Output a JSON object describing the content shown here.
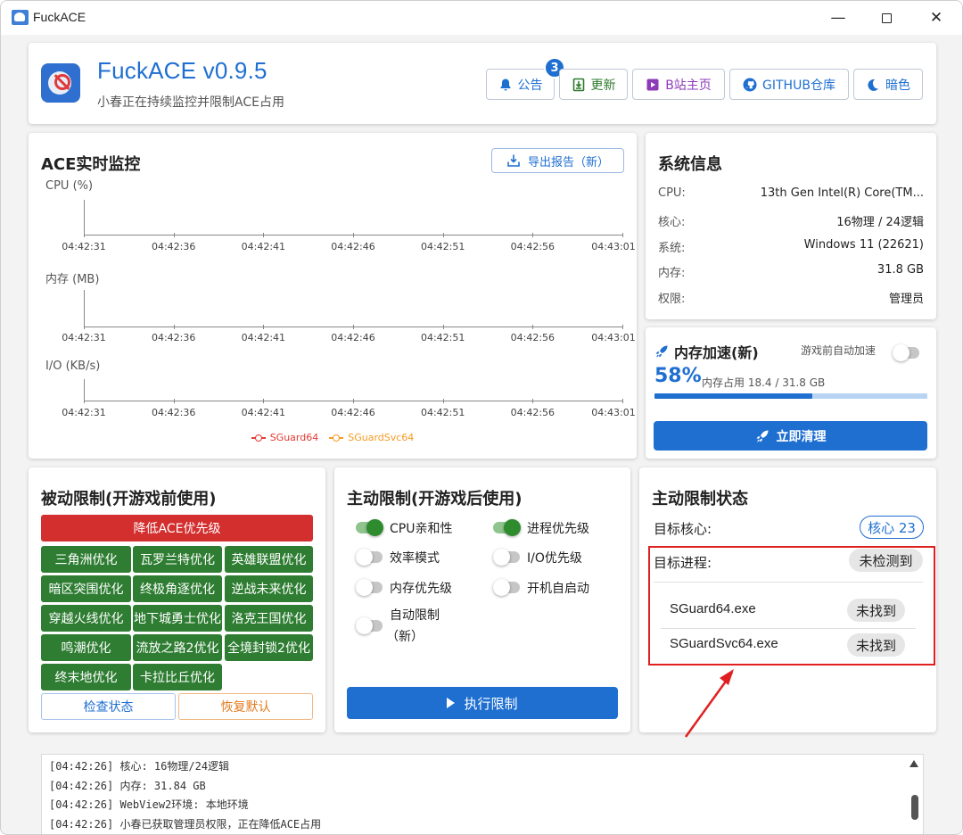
{
  "window": {
    "title": "FuckACE"
  },
  "header": {
    "app_name": "FuckACE v0.9.5",
    "subtitle": "小春正在持续监控并限制ACE占用",
    "notice_badge": "3",
    "buttons": {
      "notice": "公告",
      "update": "更新",
      "bilibili": "B站主页",
      "github": "GITHUB仓库",
      "dark": "暗色"
    }
  },
  "monitor": {
    "title": "ACE实时监控",
    "export_label": "导出报告（新）",
    "panels": [
      {
        "label": "CPU (%)"
      },
      {
        "label": "内存 (MB)"
      },
      {
        "label": "I/O (KB/s)"
      }
    ],
    "time_ticks": [
      "04:42:31",
      "04:42:36",
      "04:42:41",
      "04:42:46",
      "04:42:51",
      "04:42:56",
      "04:43:01"
    ],
    "legend": [
      {
        "name": "SGuard64",
        "color": "#e53935"
      },
      {
        "name": "SGuardSvc64",
        "color": "#f59a23"
      }
    ]
  },
  "system": {
    "title": "系统信息",
    "rows": [
      {
        "k": "CPU:",
        "v": "13th Gen Intel(R) Core(TM..."
      },
      {
        "k": "核心:",
        "v": "16物理 / 24逻辑"
      },
      {
        "k": "系统:",
        "v": "Windows 11 (22621)"
      },
      {
        "k": "内存:",
        "v": "31.8 GB"
      },
      {
        "k": "权限:",
        "v": "管理员"
      }
    ]
  },
  "memory_boost": {
    "title": "内存加速(新)",
    "auto_label": "游戏前自动加速",
    "auto_on": false,
    "percent_text": "58%",
    "percent": 58,
    "usage_text": "内存占用  18.4 / 31.8 GB",
    "clean_label": "立即清理"
  },
  "passive": {
    "title": "被动限制(开游戏前使用)",
    "lower_priority": "降低ACE优先级",
    "games": [
      "三角洲优化",
      "瓦罗兰特优化",
      "英雄联盟优化",
      "暗区突围优化",
      "终极角逐优化",
      "逆战未来优化",
      "穿越火线优化",
      "地下城勇士优化",
      "洛克王国优化",
      "鸣潮优化",
      "流放之路2优化",
      "全境封锁2优化",
      "终末地优化",
      "卡拉比丘优化"
    ],
    "check_status": "检查状态",
    "restore_default": "恢复默认"
  },
  "active": {
    "title": "主动限制(开游戏后使用)",
    "options": [
      {
        "label": "CPU亲和性",
        "on": true
      },
      {
        "label": "进程优先级",
        "on": true
      },
      {
        "label": "效率模式",
        "on": false
      },
      {
        "label": "I/O优先级",
        "on": false
      },
      {
        "label": "内存优先级",
        "on": false
      },
      {
        "label": "开机自启动",
        "on": false
      },
      {
        "label": "自动限制",
        "on": false
      }
    ],
    "auto_limit_note": "（新）",
    "execute_label": "执行限制"
  },
  "status": {
    "title": "主动限制状态",
    "target_core_label": "目标核心:",
    "target_core_value": "核心 23",
    "target_process_label": "目标进程:",
    "target_process_value": "未检测到",
    "processes": [
      {
        "name": "SGuard64.exe",
        "state": "未找到"
      },
      {
        "name": "SGuardSvc64.exe",
        "state": "未找到"
      }
    ]
  },
  "log": {
    "lines": [
      "[04:42:26] 核心: 16物理/24逻辑",
      "[04:42:26] 内存: 31.84 GB",
      "[04:42:26] WebView2环境: 本地环境",
      "[04:42:26] 小春已获取管理员权限，正在降低ACE占用"
    ]
  }
}
